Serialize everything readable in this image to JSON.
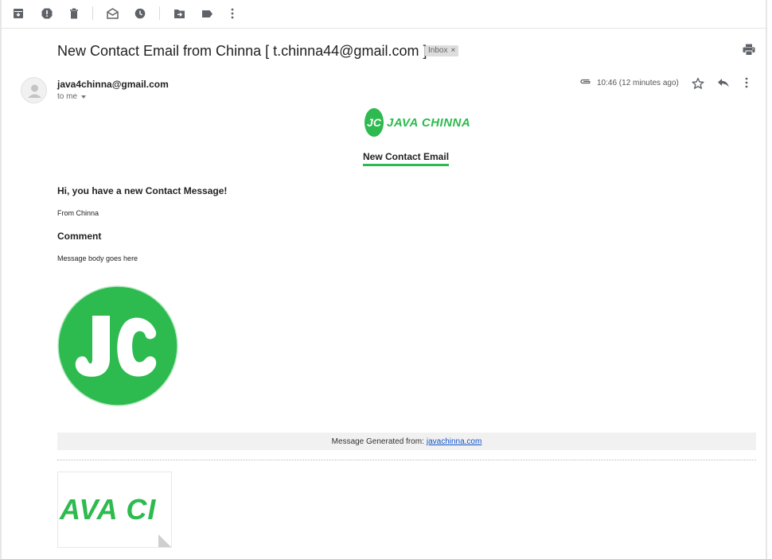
{
  "toolbar": {
    "icons": [
      "archive-icon",
      "report-spam-icon",
      "delete-icon",
      "mark-unread-icon",
      "snooze-icon",
      "move-to-icon",
      "label-icon",
      "more-vert-icon"
    ]
  },
  "email": {
    "subject": "New Contact Email from Chinna [ t.chinna44@gmail.com ]",
    "label": "Inbox",
    "label_close": "×",
    "sender": "java4chinna@gmail.com",
    "recipient": "to me",
    "time": "10:46 (12 minutes ago)"
  },
  "body": {
    "logo_initials": "JC",
    "logo_wordmark": "JAVA CHINNA",
    "title": "New Contact Email",
    "greeting": "Hi, you have a new Contact Message!",
    "from": "From Chinna",
    "comment_heading": "Comment",
    "message": "Message body goes here",
    "footer_prefix": "Message Generated from:",
    "footer_link": "javachinna.com"
  },
  "attachment": {
    "preview_text": "AVA CI"
  },
  "colors": {
    "brand_green": "#2dba4e",
    "link_blue": "#1155cc",
    "icon_gray": "#5f6368"
  }
}
